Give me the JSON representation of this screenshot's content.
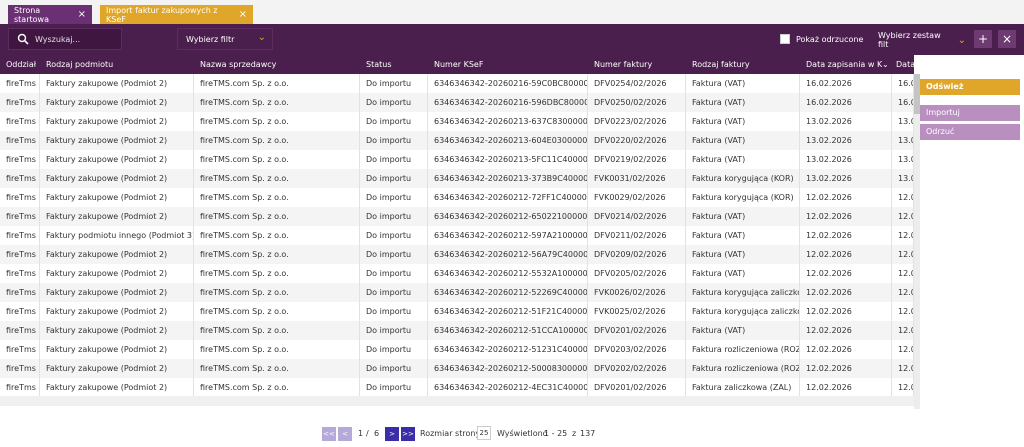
{
  "tabs": [
    {
      "label": "Strona startowa",
      "active": false
    },
    {
      "label": "Import faktur zakupowych z KSeF",
      "active": true
    }
  ],
  "toolbar": {
    "search_placeholder": "Wyszukaj...",
    "filter_label": "Wybierz filtr",
    "show_rejected_label": "Pokaż odrzucone",
    "filterset_label": "Wybierz zestaw filt",
    "add_icon": "plus-icon",
    "clear_icon": "close-icon"
  },
  "columns": [
    "Oddział",
    "Rodzaj podmiotu",
    "Nazwa sprzedawcy",
    "Status",
    "Numer KSeF",
    "Numer faktury",
    "Rodzaj faktury",
    "Data zapisania w KSe",
    "Data ..."
  ],
  "rows": [
    [
      "fireTms",
      "Faktury zakupowe (Podmiot 2)",
      "fireTMS.com Sp. z o.o.",
      "Do importu",
      "6346346342-20260216-59C0BC800000-70",
      "DFV0254/02/2026",
      "Faktura (VAT)",
      "16.02.2026",
      "16.02"
    ],
    [
      "fireTms",
      "Faktury zakupowe (Podmiot 2)",
      "fireTMS.com Sp. z o.o.",
      "Do importu",
      "6346346342-20260216-596DBC800001-3E",
      "DFV0250/02/2026",
      "Faktura (VAT)",
      "16.02.2026",
      "16.02"
    ],
    [
      "fireTms",
      "Faktury zakupowe (Podmiot 2)",
      "fireTMS.com Sp. z o.o.",
      "Do importu",
      "6346346342-20260213-637C83000000-23",
      "DFV0223/02/2026",
      "Faktura (VAT)",
      "13.02.2026",
      "13.02"
    ],
    [
      "fireTms",
      "Faktury zakupowe (Podmiot 2)",
      "fireTMS.com Sp. z o.o.",
      "Do importu",
      "6346346342-20260213-604E03000000-9F",
      "DFV0220/02/2026",
      "Faktura (VAT)",
      "13.02.2026",
      "13.02"
    ],
    [
      "fireTms",
      "Faktury zakupowe (Podmiot 2)",
      "fireTMS.com Sp. z o.o.",
      "Do importu",
      "6346346342-20260213-5FC11C400000-E8",
      "DFV0219/02/2026",
      "Faktura (VAT)",
      "13.02.2026",
      "13.02"
    ],
    [
      "fireTms",
      "Faktury zakupowe (Podmiot 2)",
      "fireTMS.com Sp. z o.o.",
      "Do importu",
      "6346346342-20260213-373B9C400000-83",
      "FVK0031/02/2026",
      "Faktura korygująca (KOR)",
      "13.02.2026",
      "13.02"
    ],
    [
      "fireTms",
      "Faktury zakupowe (Podmiot 2)",
      "fireTMS.com Sp. z o.o.",
      "Do importu",
      "6346346342-20260212-72FF1C400000-35",
      "FVK0029/02/2026",
      "Faktura korygująca (KOR)",
      "12.02.2026",
      "12.02"
    ],
    [
      "fireTms",
      "Faktury zakupowe (Podmiot 2)",
      "fireTMS.com Sp. z o.o.",
      "Do importu",
      "6346346342-20260212-650221000000-DB",
      "DFV0214/02/2026",
      "Faktura (VAT)",
      "12.02.2026",
      "12.02"
    ],
    [
      "fireTms",
      "Faktury podmiotu innego (Podmiot 3)",
      "fireTMS.com Sp. z o.o.",
      "Do importu",
      "6346346342-20260212-597A21000000-BE",
      "DFV0211/02/2026",
      "Faktura (VAT)",
      "12.02.2026",
      "12.02"
    ],
    [
      "fireTms",
      "Faktury zakupowe (Podmiot 2)",
      "fireTMS.com Sp. z o.o.",
      "Do importu",
      "6346346342-20260212-56A79C400001-98",
      "DFV0209/02/2026",
      "Faktura (VAT)",
      "12.02.2026",
      "12.02"
    ],
    [
      "fireTms",
      "Faktury zakupowe (Podmiot 2)",
      "fireTMS.com Sp. z o.o.",
      "Do importu",
      "6346346342-20260212-5532A1000000-34",
      "DFV0205/02/2026",
      "Faktura (VAT)",
      "12.02.2026",
      "12.02"
    ],
    [
      "fireTms",
      "Faktury zakupowe (Podmiot 2)",
      "fireTMS.com Sp. z o.o.",
      "Do importu",
      "6346346342-20260212-52269C400000-D5",
      "FVK0026/02/2026",
      "Faktura korygująca zaliczkowa (",
      "12.02.2026",
      "12.02"
    ],
    [
      "fireTms",
      "Faktury zakupowe (Podmiot 2)",
      "fireTMS.com Sp. z o.o.",
      "Do importu",
      "6346346342-20260212-51F21C400000-DF",
      "FVK0025/02/2026",
      "Faktura korygująca zaliczkowa (",
      "12.02.2026",
      "12.02"
    ],
    [
      "fireTms",
      "Faktury zakupowe (Podmiot 2)",
      "fireTMS.com Sp. z o.o.",
      "Do importu",
      "6346346342-20260212-51CCA1000000-54",
      "DFV0201/02/2026",
      "Faktura (VAT)",
      "12.02.2026",
      "12.02"
    ],
    [
      "fireTms",
      "Faktury zakupowe (Podmiot 2)",
      "fireTMS.com Sp. z o.o.",
      "Do importu",
      "6346346342-20260212-51231C400000-F6",
      "DFV0203/02/2026",
      "Faktura rozliczeniowa (ROZ)",
      "12.02.2026",
      "12.02"
    ],
    [
      "fireTms",
      "Faktury zakupowe (Podmiot 2)",
      "fireTMS.com Sp. z o.o.",
      "Do importu",
      "6346346342-20260212-500083000000-AA",
      "DFV0202/02/2026",
      "Faktura rozliczeniowa (ROZ)",
      "12.02.2026",
      "12.02"
    ],
    [
      "fireTms",
      "Faktury zakupowe (Podmiot 2)",
      "fireTMS.com Sp. z o.o.",
      "Do importu",
      "6346346342-20260212-4EC31C400000-83",
      "DFV0201/02/2026",
      "Faktura zaliczkowa (ZAL)",
      "12.02.2026",
      "12.02"
    ]
  ],
  "side": {
    "refresh_label": "Odśwież",
    "import_label": "Importuj",
    "reject_label": "Odrzuć"
  },
  "pager": {
    "first": "<<",
    "prev": "<",
    "next": ">",
    "last": ">>",
    "current_page": "1",
    "separator": "/",
    "total_pages": "6",
    "size_label": "Rozmiar strony:",
    "size_value": "25",
    "shown_label": "Wyświetlono",
    "shown_range": "1 - 25",
    "of_label": "z",
    "total": "137"
  }
}
